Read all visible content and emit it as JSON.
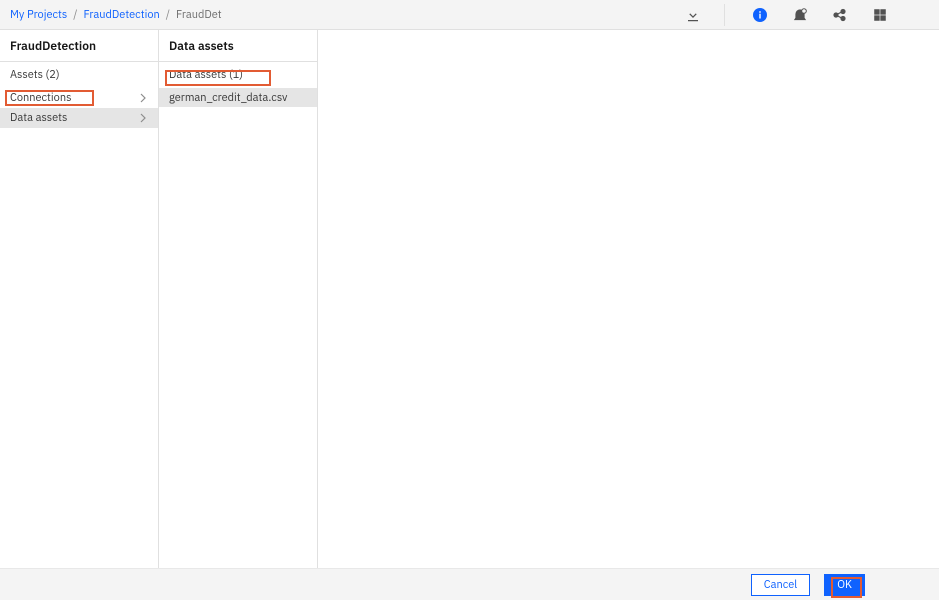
{
  "breadcrumb": {
    "items": [
      {
        "label": "My Projects",
        "link": true
      },
      {
        "label": "FraudDetection",
        "link": true
      },
      {
        "label": "FraudDet",
        "link": false
      }
    ]
  },
  "sidebar": {
    "title": "FraudDetection",
    "assets_label": "Assets (2)",
    "items": [
      {
        "label": "Connections"
      },
      {
        "label": "Data assets"
      }
    ]
  },
  "panel2": {
    "title": "Data assets",
    "sub": "Data assets (1)",
    "files": [
      {
        "name": "german_credit_data.csv"
      }
    ]
  },
  "footer": {
    "cancel": "Cancel",
    "ok": "OK"
  }
}
